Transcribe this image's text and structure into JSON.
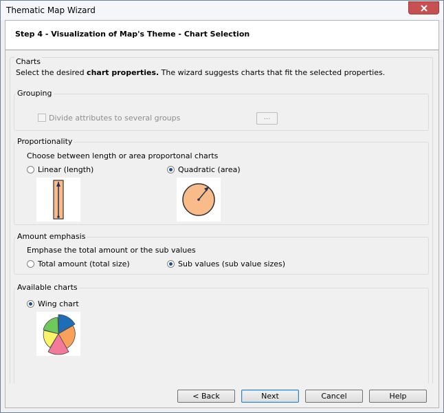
{
  "window": {
    "title": "Thematic Map Wizard"
  },
  "header": {
    "step_title": "Step 4 - Visualization of Map's Theme - Chart Selection"
  },
  "charts": {
    "title": "Charts",
    "desc_prefix": "Select the desired ",
    "desc_bold": "chart properties.",
    "desc_suffix": " The wizard suggests charts that fit the selected properties."
  },
  "grouping": {
    "title": "Grouping",
    "checkbox_label": "Divide attributes to several groups",
    "checkbox_checked": false,
    "button_label": "..."
  },
  "proportionality": {
    "title": "Proportionality",
    "desc": "Choose between length or area proportonal charts",
    "option_linear": "Linear (length)",
    "option_quadratic": "Quadratic (area)",
    "selected": "quadratic"
  },
  "amount_emphasis": {
    "title": "Amount emphasis",
    "desc": "Emphase the total amount or the sub values",
    "option_total": "Total amount (total size)",
    "option_sub": "Sub values (sub value sizes)",
    "selected": "sub"
  },
  "available_charts": {
    "title": "Available charts",
    "option_wing": "Wing chart",
    "selected": "wing"
  },
  "footer": {
    "back_label": "< Back",
    "next_label": "Next",
    "cancel_label": "Cancel",
    "help_label": "Help"
  },
  "colors": {
    "accent": "#1e4e8c",
    "proportion_fill": "#f9bb8a",
    "wing_blue": "#1f6db5",
    "wing_orange": "#f9a15a",
    "wing_pink": "#f47a9c",
    "wing_yellow": "#fbf46a",
    "wing_green": "#6fc95a"
  },
  "icons": {
    "close": "close-icon",
    "linear_chart": "linear-length-chart-icon",
    "quadratic_chart": "quadratic-area-chart-icon",
    "wing_chart": "wing-chart-icon"
  }
}
